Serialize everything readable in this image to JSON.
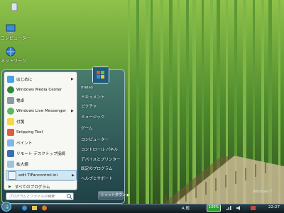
{
  "desktop": {
    "icons": [
      {
        "label": "コンピューター",
        "icon": "computer-icon"
      },
      {
        "label": "ネットワーク",
        "icon": "network-icon"
      }
    ],
    "watermark": "Windows 7"
  },
  "start_menu": {
    "left_items": [
      {
        "label": "はじめに",
        "icon": "getting-started-icon",
        "arrow": "▶"
      },
      {
        "label": "Windows Media Center",
        "icon": "media-center-icon",
        "arrow": ""
      },
      {
        "label": "電卓",
        "icon": "calculator-icon",
        "arrow": ""
      },
      {
        "label": "Windows Live Messenger",
        "icon": "messenger-icon",
        "arrow": "▶"
      },
      {
        "label": "付箋",
        "icon": "sticky-notes-icon",
        "arrow": ""
      },
      {
        "label": "Snipping Tool",
        "icon": "snipping-tool-icon",
        "arrow": ""
      },
      {
        "label": "ペイント",
        "icon": "paint-icon",
        "arrow": ""
      },
      {
        "label": "リモート デスクトップ接続",
        "icon": "remote-desktop-icon",
        "arrow": ""
      },
      {
        "label": "拡大鏡",
        "icon": "magnifier-icon",
        "arrow": ""
      },
      {
        "label": "edit TIFancontrol.ini",
        "icon": "notepad-icon",
        "arrow": "▶"
      }
    ],
    "all_programs": "すべてのプログラム",
    "search_placeholder": "プログラムとファイルの検索",
    "right_items": [
      {
        "label": "meiso"
      },
      {
        "label": "ドキュメント"
      },
      {
        "label": "ピクチャ"
      },
      {
        "label": "ミュージック"
      },
      {
        "label": "ゲーム"
      },
      {
        "label": "コンピューター"
      },
      {
        "label": "コントロール パネル"
      },
      {
        "label": "デバイスとプリンター"
      },
      {
        "label": "既定のプログラム"
      },
      {
        "label": "ヘルプとサポート"
      }
    ],
    "shutdown_label": "シャットダウン ▶"
  },
  "taskbar": {
    "battery_text": "100%",
    "clock": "22:27",
    "tray_lang": "A 般",
    "tray_icons": [
      "ie-icon",
      "explorer-icon",
      "media-player-icon",
      "network-tray-icon",
      "volume-icon"
    ]
  },
  "colors": {
    "taskbar": "#1a2a32",
    "menu_left": "#f7f7f3",
    "highlight": "#cfe6f3"
  }
}
